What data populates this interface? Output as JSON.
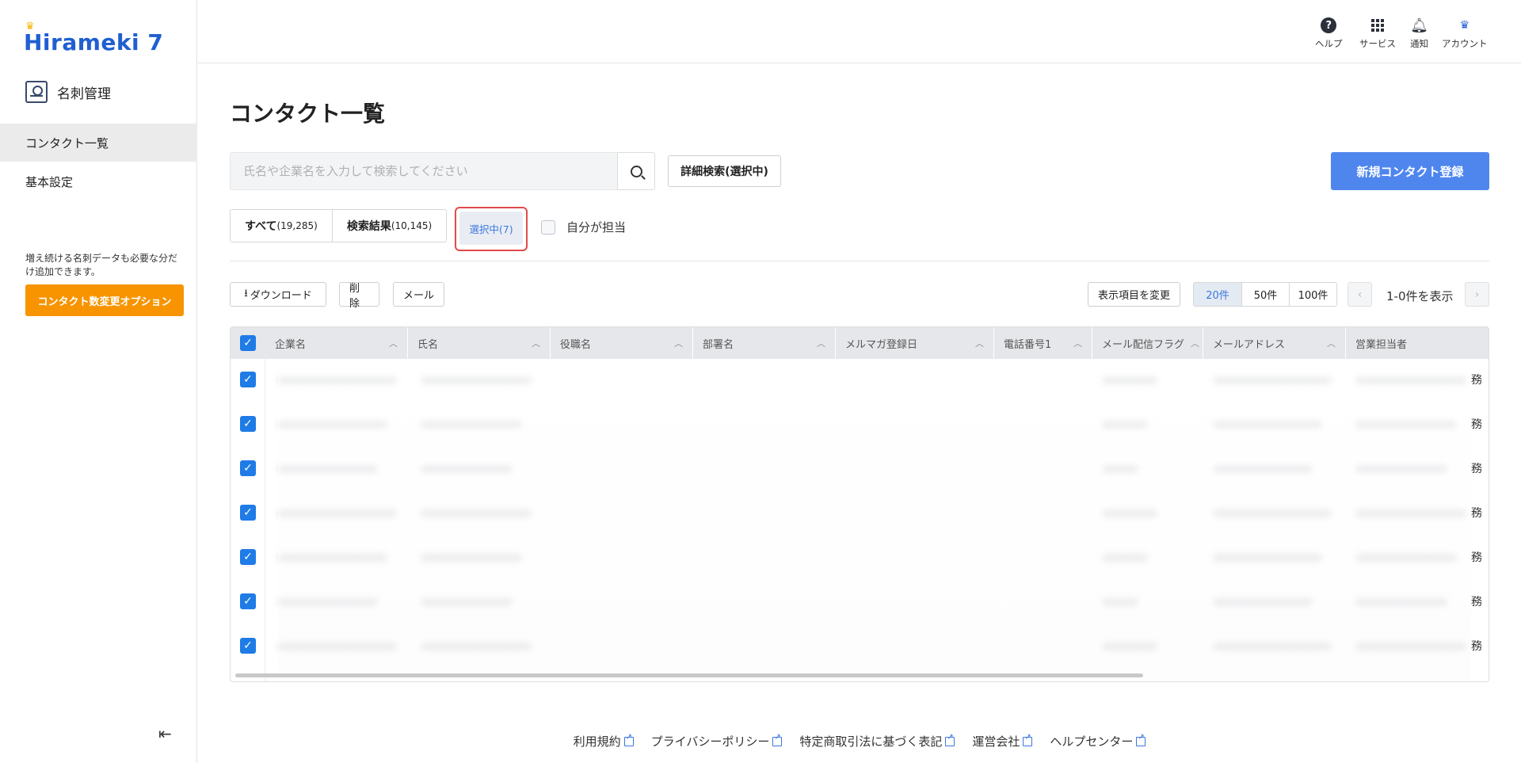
{
  "app": {
    "logo": "Hirameki 7",
    "module_name": "名刺管理"
  },
  "sidebar": {
    "items": [
      {
        "label": "コンタクト一覧",
        "active": true
      },
      {
        "label": "基本設定",
        "active": false
      }
    ],
    "note": "増え続ける名刺データも必要な分だけ追加できます。",
    "option_button": "コンタクト数変更オプション",
    "collapse_icon": "collapse-left-icon"
  },
  "header": {
    "items": [
      {
        "label": "ヘルプ",
        "icon": "help-icon"
      },
      {
        "label": "サービス",
        "icon": "grid-icon"
      },
      {
        "label": "通知",
        "icon": "bell-icon"
      },
      {
        "label": "アカウント",
        "icon": "account-icon"
      }
    ]
  },
  "main": {
    "title": "コンタクト一覧",
    "search_placeholder": "氏名や企業名を入力して検索してください",
    "advanced_search": "詳細検索(選択中)",
    "new_contact": "新規コンタクト登録",
    "tabs": [
      {
        "label": "すべて",
        "count": "(19,285)"
      },
      {
        "label": "検索結果",
        "count": "(10,145)"
      }
    ],
    "selected_tab": "選択中(7)",
    "own_filter": "自分が担当",
    "toolbar": {
      "download": "ダウンロード",
      "delete": "削除",
      "mail": "メール",
      "change_columns": "表示項目を変更",
      "per_page": [
        "20件",
        "50件",
        "100件"
      ],
      "per_page_selected": "20件",
      "range": "1-0件を表示"
    },
    "table": {
      "columns": [
        "企業名",
        "氏名",
        "役職名",
        "部署名",
        "メルマガ登録日",
        "電話番号1",
        "メール配信フラグ",
        "メールアドレス",
        "営業担当者"
      ],
      "row_count": 7,
      "row_tail": "務"
    }
  },
  "footer": {
    "links": [
      "利用規約",
      "プライバシーポリシー",
      "特定商取引法に基づく表記",
      "運営会社",
      "ヘルプセンター"
    ]
  },
  "colors": {
    "brand": "#1f5fd1",
    "primary_button": "#4f86ee",
    "option_button": "#f79400",
    "checkbox": "#1f7be6",
    "highlight": "#e24b4b"
  }
}
